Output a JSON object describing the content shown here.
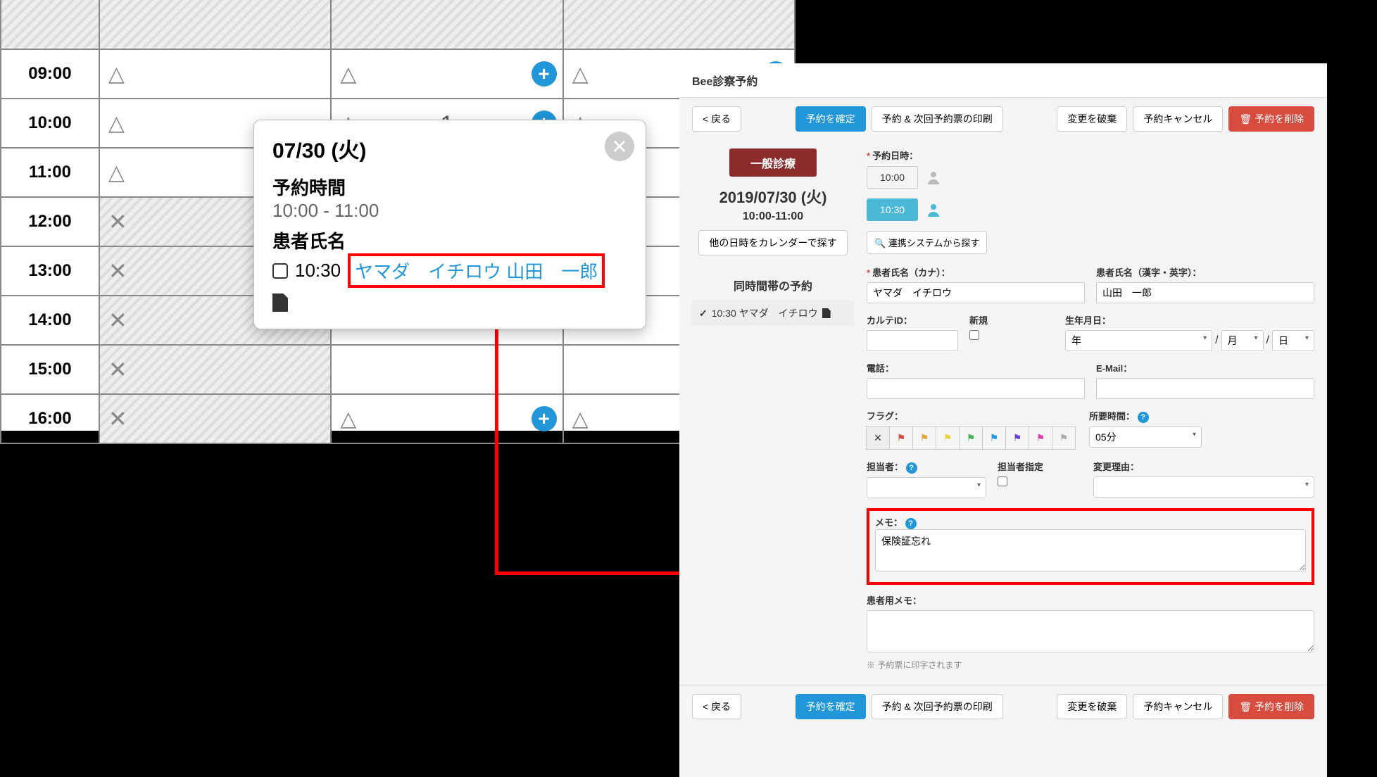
{
  "calendar": {
    "rows": [
      "09:00",
      "10:00",
      "11:00",
      "12:00",
      "13:00",
      "14:00",
      "15:00",
      "16:00"
    ],
    "cell_num": "1"
  },
  "popover": {
    "title": "07/30 (火)",
    "sec1": "予約時間",
    "time": "10:00 - 11:00",
    "sec2": "患者氏名",
    "slot": "10:30",
    "name_kana": "ヤマダ　イチロウ",
    "name_kanji": "山田　一郎"
  },
  "form": {
    "header": "Bee診察予約",
    "back": "< 戻る",
    "confirm": "予約を確定",
    "print": "予約 & 次回予約票の印刷",
    "discard": "変更を破棄",
    "cancel": "予約キャンセル",
    "delete": "予約を削除",
    "trash": "🗑",
    "badge": "一般診療",
    "date": "2019/07/30 (火)",
    "time_range": "10:00-11:00",
    "find_cal": "他の日時をカレンダーで探す",
    "same_header": "同時間帯の予約",
    "same_row": "10:30 ヤマダ　イチロウ",
    "lbl_datetime": "予約日時：",
    "slot1": "10:00",
    "slot2": "10:30",
    "search_sys": "連携システムから探す",
    "lbl_kana": "患者氏名（カナ）：",
    "lbl_kanji": "患者氏名（漢字・英字）：",
    "val_kana": "ヤマダ　イチロウ",
    "val_kanji": "山田　一郎",
    "lbl_karte": "カルテID：",
    "lbl_new": "新規",
    "lbl_dob": "生年月日：",
    "dob_y": "年",
    "dob_m": "月",
    "dob_d": "日",
    "lbl_tel": "電話：",
    "lbl_email": "E-Mail：",
    "lbl_flag": "フラグ：",
    "lbl_duration": "所要時間：",
    "duration": "05分",
    "lbl_staff": "担当者：",
    "lbl_staff_assign": "担当者指定",
    "lbl_reason": "変更理由：",
    "lbl_memo": "メモ：",
    "memo_val": "保険証忘れ",
    "lbl_patient_memo": "患者用メモ：",
    "hint": "※ 予約票に印字されます",
    "flag_colors": [
      "#888",
      "#d84b3f",
      "#e8a23c",
      "#e8d23c",
      "#3cb84b",
      "#2196d8",
      "#6b3fd8",
      "#d83faf",
      "#888"
    ]
  }
}
